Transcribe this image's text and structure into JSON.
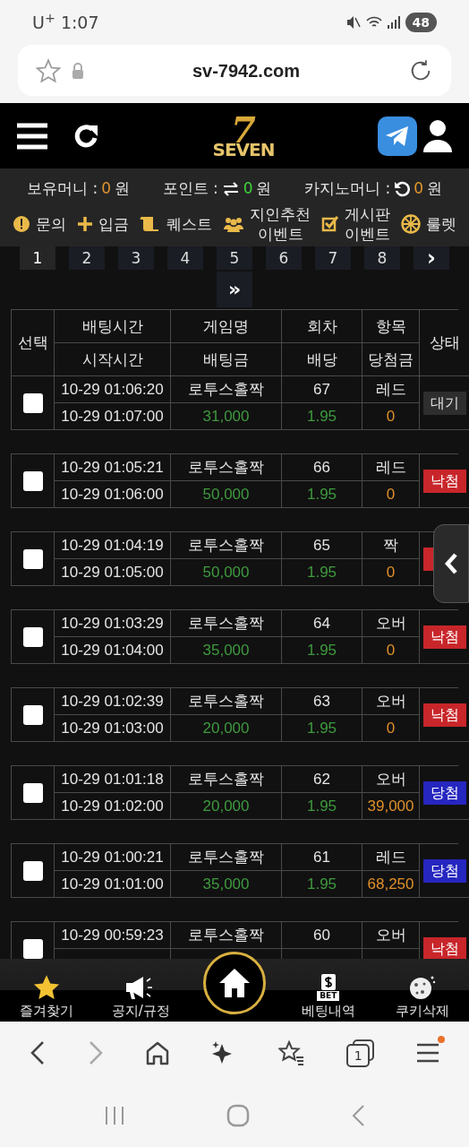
{
  "status_bar": {
    "carrier": "U$^{+}$",
    "time": "1:07",
    "battery": "48"
  },
  "url_bar": {
    "url": "sv-7942.com"
  },
  "header": {
    "logo": {
      "numeral": "7",
      "word": "SEVEN"
    }
  },
  "balances": [
    {
      "label": "보유머니 :",
      "value": "0",
      "unit": "원",
      "color": "#e0962e"
    },
    {
      "label": "포인트 :",
      "value": "0",
      "unit": "원",
      "color": "#3fd43f"
    },
    {
      "label": "카지노머니 :",
      "value": "0",
      "unit": "원",
      "color": "#e0962e"
    }
  ],
  "menu": [
    {
      "label": "문의"
    },
    {
      "label": "입금"
    },
    {
      "label": "퀘스트"
    },
    {
      "label": "지인추천\n이벤트"
    },
    {
      "label": "게시판\n이벤트"
    },
    {
      "label": "룰렛"
    }
  ],
  "pagination": {
    "pages": [
      {
        "label": "1",
        "selected": true
      },
      {
        "label": "2",
        "selected": false
      },
      {
        "label": "3",
        "selected": false
      },
      {
        "label": "4",
        "selected": false
      },
      {
        "label": "5",
        "selected": false
      },
      {
        "label": "6",
        "selected": false
      },
      {
        "label": "7",
        "selected": false
      },
      {
        "label": "8",
        "selected": false
      }
    ],
    "next": "›",
    "last": "»"
  },
  "table": {
    "columns": {
      "select": "선택",
      "bet_time": "배팅시간",
      "start_time": "시작시간",
      "game": "게임명",
      "stake": "배팅금",
      "round": "회차",
      "odds": "배당",
      "pick": "항목",
      "payout": "당첨금",
      "status": "상태"
    },
    "rows": [
      {
        "checked": false,
        "bet_time": "10-29 01:06:20",
        "start_time": "10-29 01:07:00",
        "game": "로투스홀짝",
        "stake": "31,000",
        "round": "67",
        "odds": "1.95",
        "pick": "레드",
        "payout": "0",
        "status": {
          "kind": "wait",
          "label": "대기"
        }
      },
      {
        "checked": false,
        "bet_time": "10-29 01:05:21",
        "start_time": "10-29 01:06:00",
        "game": "로투스홀짝",
        "stake": "50,000",
        "round": "66",
        "odds": "1.95",
        "pick": "레드",
        "payout": "0",
        "status": {
          "kind": "lose",
          "label": "낙첨"
        }
      },
      {
        "checked": false,
        "bet_time": "10-29 01:04:19",
        "start_time": "10-29 01:05:00",
        "game": "로투스홀짝",
        "stake": "50,000",
        "round": "65",
        "odds": "1.95",
        "pick": "짝",
        "payout": "0",
        "status": {
          "kind": "lose"
        }
      },
      {
        "checked": false,
        "bet_time": "10-29 01:03:29",
        "start_time": "10-29 01:04:00",
        "game": "로투스홀짝",
        "stake": "35,000",
        "round": "64",
        "odds": "1.95",
        "pick": "오버",
        "payout": "0",
        "status": {
          "kind": "lose",
          "label": "낙첨"
        }
      },
      {
        "checked": false,
        "bet_time": "10-29 01:02:39",
        "start_time": "10-29 01:03:00",
        "game": "로투스홀짝",
        "stake": "20,000",
        "round": "63",
        "odds": "1.95",
        "pick": "오버",
        "payout": "0",
        "status": {
          "kind": "lose",
          "label": "낙첨"
        }
      },
      {
        "checked": false,
        "bet_time": "10-29 01:01:18",
        "start_time": "10-29 01:02:00",
        "game": "로투스홀짝",
        "stake": "20,000",
        "round": "62",
        "odds": "1.95",
        "pick": "오버",
        "payout": "39,000",
        "status": {
          "kind": "win",
          "label": "당첨"
        }
      },
      {
        "checked": false,
        "bet_time": "10-29 01:00:21",
        "start_time": "10-29 01:01:00",
        "game": "로투스홀짝",
        "stake": "35,000",
        "round": "61",
        "odds": "1.95",
        "pick": "레드",
        "payout": "68,250",
        "status": {
          "kind": "win",
          "label": "당첨"
        }
      },
      {
        "checked": false,
        "bet_time": "10-29 00:59:23",
        "game": "로투스홀짝",
        "round": "60",
        "pick": "오버",
        "status": {
          "kind": "lose",
          "label": "낙첨"
        }
      }
    ]
  },
  "bottom_nav": [
    {
      "kind": "favorite",
      "label": "즐겨찾기"
    },
    {
      "kind": "notice",
      "label": "공지/규정"
    },
    {
      "kind": "home"
    },
    {
      "kind": "bets",
      "label": "베팅내역",
      "icon_text": "BET"
    },
    {
      "kind": "cookie",
      "label": "쿠키삭제"
    }
  ],
  "browser_toolbar": {
    "forward_enabled": false,
    "tab_count": "1",
    "menu_badge": true
  }
}
